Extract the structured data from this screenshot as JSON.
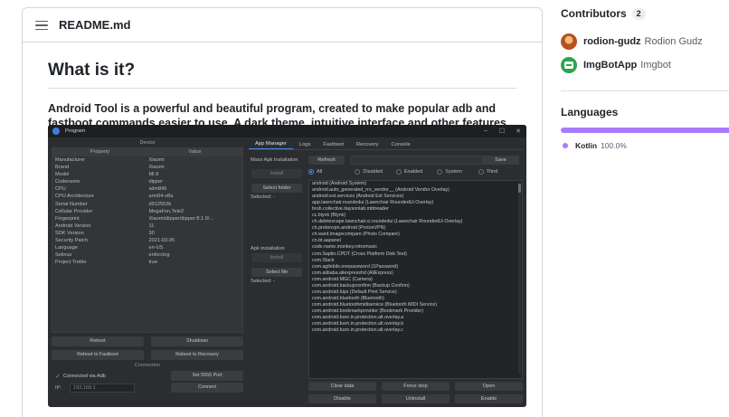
{
  "readme": {
    "filename": "README.md",
    "heading": "What is it?",
    "description": "Android Tool is a powerful and beautiful program, created to make popular adb and fastboot commands easier to use. A dark theme, intuitive interface and other features"
  },
  "app": {
    "window_title": "Program",
    "window_controls": [
      "–",
      "☐",
      "✕"
    ],
    "device_title": "Device",
    "columns": [
      "Property",
      "Value"
    ],
    "device_props": [
      [
        "Manufacturer",
        "Xiaomi"
      ],
      [
        "Brand",
        "Xiaomi"
      ],
      [
        "Model",
        "MI 8"
      ],
      [
        "Codename",
        "dipper"
      ],
      [
        "CPU",
        "sdm845"
      ],
      [
        "CPU Architecture",
        "arm64-v8a"
      ],
      [
        "Serial Number",
        "d912553b"
      ],
      [
        "Cellular Provider",
        "MegaFon,Tele2"
      ],
      [
        "Fingerprint",
        "Xiaomi/dipper/dipper:8.1.0/..."
      ],
      [
        "Android Version",
        "11"
      ],
      [
        "SDK Version",
        "30"
      ],
      [
        "Security Patch",
        "2021-03-05"
      ],
      [
        "Language",
        "en-US"
      ],
      [
        "Selinux",
        "enforcing"
      ],
      [
        "Project Treble",
        "true"
      ]
    ],
    "reboot": "Reboot",
    "shutdown": "Shutdown",
    "reboot_fastboot": "Reboot to Fastboot",
    "reboot_recovery": "Reboot to Recovery",
    "connection_title": "Connection",
    "connected_via": "Connected via Adb",
    "set_port": "Set 5555 Port",
    "ip_label": "IP:",
    "ip_placeholder": "192.168.1.",
    "connect": "Connect",
    "tabs": [
      "App Manager",
      "Logs",
      "Fastboot",
      "Recovery",
      "Console"
    ],
    "mass_install_label": "Mass Apk Installation",
    "refresh": "Refresh",
    "save": "Save",
    "install": "Install",
    "select_folder": "Select folder",
    "selected": "Selected: -",
    "apk_install_label": "Apk installation",
    "install2": "Install",
    "select_file": "Select file",
    "selected2": "Selected: -",
    "filters": [
      "All",
      "Disabled",
      "Enabled",
      "System",
      "Third"
    ],
    "packages": [
      "android (Android System)",
      "android.auto_generated_rro_vendor__ (Android Vendor Overlay)",
      "android.ext.services (Android Ext Services)",
      "app.lawnchair.roundedui (Lawnchair RoundedUi Overlay)",
      "bruh.collective.itaysonlab.mbtreader",
      "cc.blynk (Blynk)",
      "ch.deletescape.lawnchair.ci.roundedui (Lawnchair RoundedUi Overlay)",
      "ch.protonvpn.android (ProtonVPN)",
      "ch.want.imagecompare (Photo Compare)",
      "cn.bt.aapanel",
      "code.name.monkey.retromusic",
      "com.Saplin.CPDT (Cross Platform Disk Test)",
      "com.Slack",
      "com.agilebits.onepassword (1Password)",
      "com.alibaba.aliexpresshd (AliExpress)",
      "com.android.MGC (Camera)",
      "com.android.backupconfirm (Backup Confirm)",
      "com.android.bips (Default Print Service)",
      "com.android.bluetooth (Bluetooth)",
      "com.android.bluetoothmidiservice (Bluetooth MIDI Service)",
      "com.android.bookmarkprovider (Bookmark Provider)",
      "com.android.burn.in.protection.alt.overlay.a",
      "com.android.burn.in.protection.alt.overlay.b",
      "com.android.burn.in.protection.alt.overlay.c"
    ],
    "actions": [
      "Clear data",
      "Force stop",
      "Open",
      "Disable",
      "Uninstall",
      "Enable"
    ]
  },
  "sidebar": {
    "contributors_title": "Contributors",
    "contributors_count": "2",
    "contributors": [
      {
        "login": "rodion-gudz",
        "name": "Rodion Gudz"
      },
      {
        "login": "ImgBotApp",
        "name": "Imgbot"
      }
    ],
    "languages_title": "Languages",
    "languages": [
      {
        "name": "Kotlin",
        "percent": "100.0%",
        "color": "#A97BFF"
      }
    ]
  }
}
